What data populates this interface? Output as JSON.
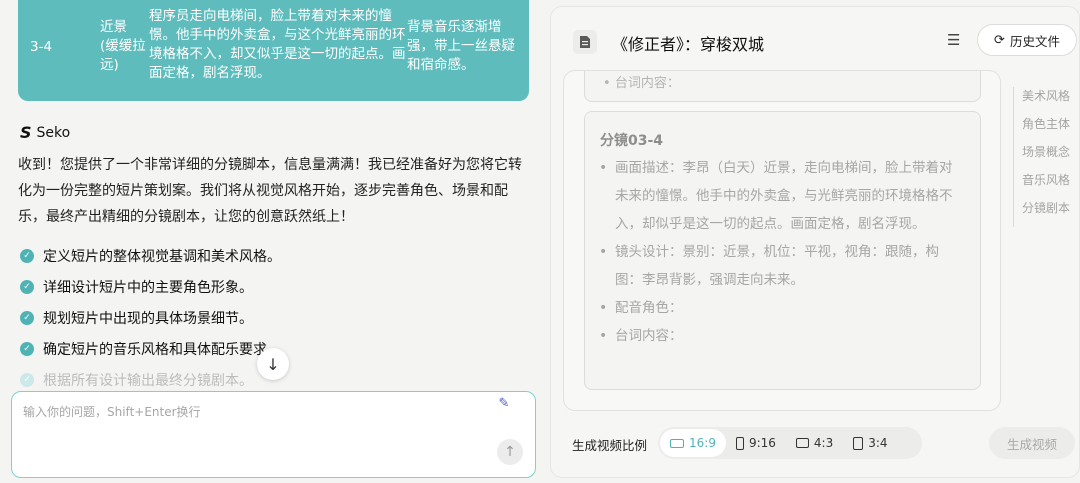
{
  "chat": {
    "shot_row": {
      "id": "3-4",
      "shot_type": "近景\n(缓缓拉\n远)",
      "visual": "程序员走向电梯间，脸上带着对未来的憧憬。他手中的外卖盒，与这个光鲜亮丽的环境格格不入，却又似乎是这一切的起点。画面定格，剧名浮现。",
      "audio": "背景音乐逐渐增强，带上一丝悬疑和宿命感。"
    },
    "brand": "Seko",
    "intro": "收到！您提供了一个非常详细的分镜脚本，信息量满满！我已经准备好为您将它转化为一份完整的短片策划案。我们将从视觉风格开始，逐步完善角色、场景和配乐，最终产出精细的分镜剧本，让您的创意跃然纸上！",
    "checklist": [
      "定义短片的整体视觉基调和美术风格。",
      "详细设计短片中的主要角色形象。",
      "规划短片中出现的具体场景细节。",
      "确定短片的音乐风格和具体配乐要求",
      "根据所有设计输出最终分镜剧本。"
    ],
    "input_placeholder": "输入你的问题，Shift+Enter换行"
  },
  "doc": {
    "title": "《修正者》：穿梭双城",
    "history_label": "历史文件",
    "prev_card_text": "台词内容：",
    "card": {
      "title": "分镜03-4",
      "items": [
        "画面描述：李昂（白天）近景，走向电梯间，脸上带着对未来的憧憬。他手中的外卖盒，与光鲜亮丽的环境格格不入，却似乎是这一切的起点。画面定格，剧名浮现。",
        "镜头设计：景别：近景，机位：平视，视角：跟随，构图：李昂背影，强调走向未来。",
        "配音角色：",
        "台词内容："
      ]
    },
    "toc": [
      "美术风格",
      "角色主体",
      "场景概念",
      "音乐风格",
      "分镜剧本"
    ],
    "ratio_label": "生成视频比例",
    "ratios": [
      "16:9",
      "9:16",
      "4:3",
      "3:4"
    ],
    "active_ratio": "16:9",
    "generate_label": "生成视频"
  },
  "colors": {
    "accent": "#5ebcbd",
    "teal_text": "#4fb3b6"
  }
}
